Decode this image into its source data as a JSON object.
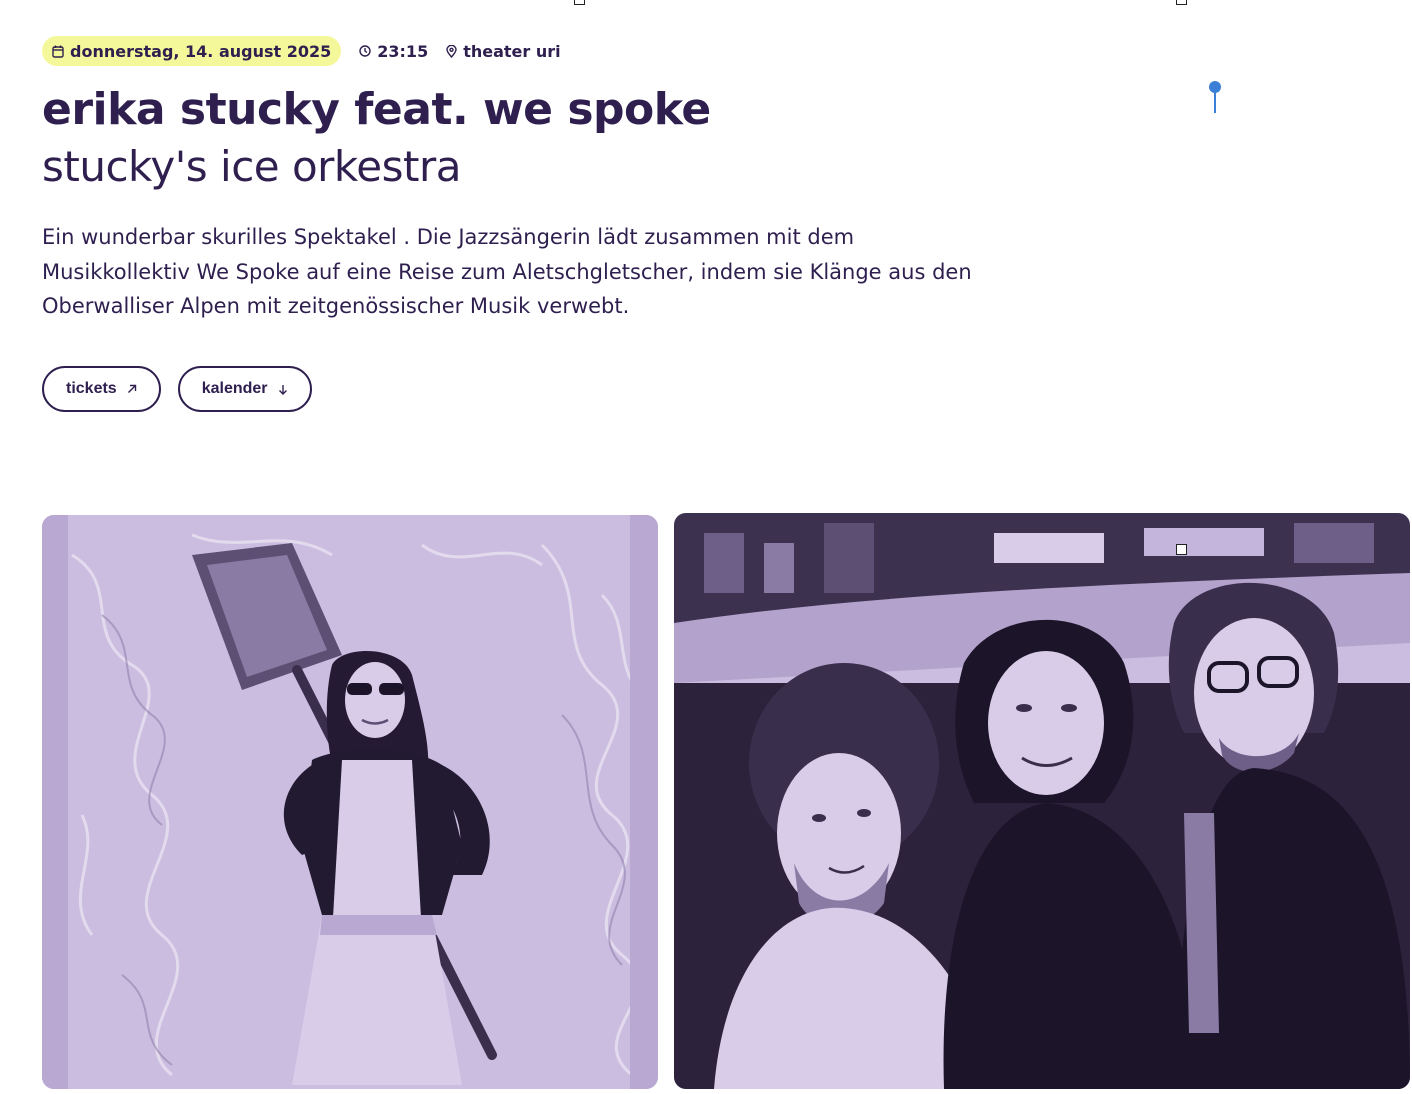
{
  "event": {
    "date": "donnerstag, 14. august 2025",
    "time": "23:15",
    "venue": "theater uri",
    "title": "erika stucky feat. we spoke",
    "subtitle": "stucky's ice orkestra",
    "description": "Ein wunderbar skurilles Spektakel . Die Jazzsängerin lädt zusammen mit dem Musikkollektiv We Spoke auf eine Reise zum Aletschgletscher, indem sie Klänge aus den Oberwalliser Alpen mit zeitgenössischer Musik verwebt."
  },
  "actions": {
    "tickets_label": "tickets",
    "calendar_label": "kalender"
  },
  "icons": {
    "date": "calendar-icon",
    "time": "clock-icon",
    "venue": "location-pin-icon",
    "tickets": "arrow-up-right-icon",
    "calendar": "arrow-down-icon",
    "map_pin": "map-pin-icon"
  },
  "colors": {
    "text": "#2e1f4f",
    "date_highlight": "#f5f89a",
    "photo_tint": "#cfc2e2",
    "map_pin": "#3b7fd6"
  }
}
